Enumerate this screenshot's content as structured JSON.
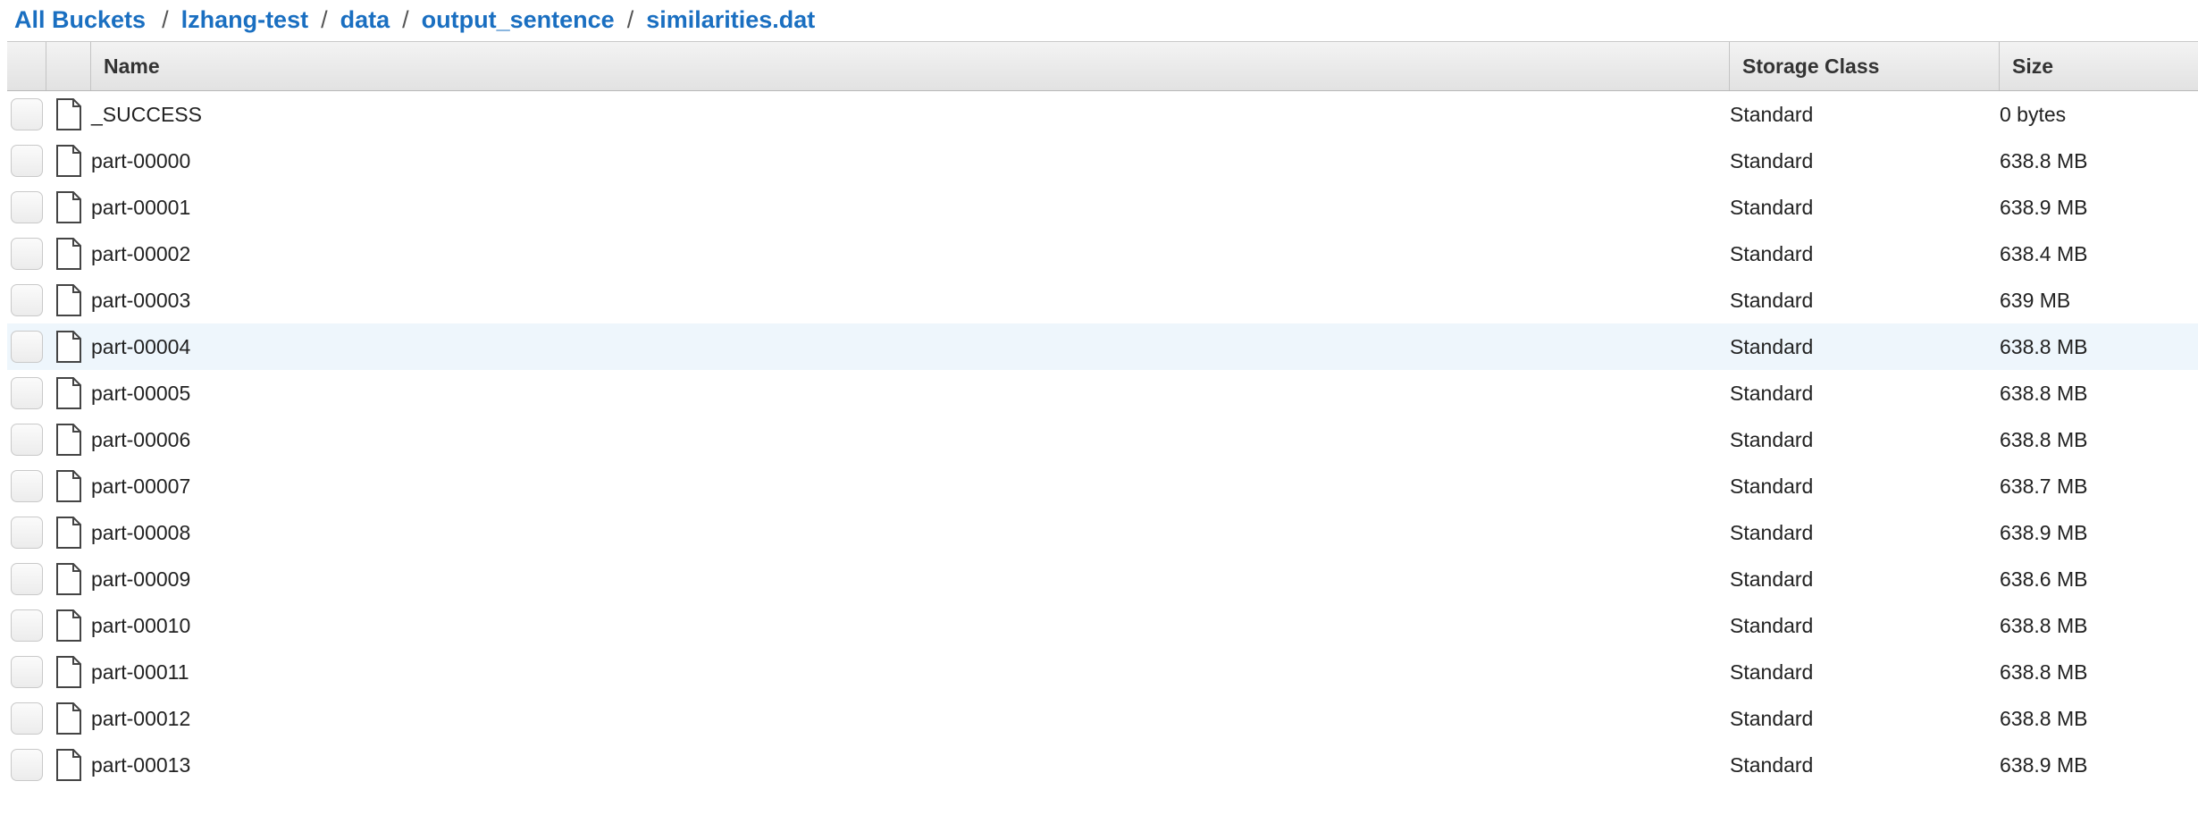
{
  "breadcrumb": {
    "root": "All Buckets",
    "separator": "/",
    "segments": [
      "lzhang-test",
      "data",
      "output_sentence",
      "similarities.dat"
    ]
  },
  "table": {
    "columns": {
      "name": "Name",
      "storage": "Storage Class",
      "size": "Size"
    },
    "rows": [
      {
        "name": "_SUCCESS",
        "storage": "Standard",
        "size": "0 bytes"
      },
      {
        "name": "part-00000",
        "storage": "Standard",
        "size": "638.8 MB"
      },
      {
        "name": "part-00001",
        "storage": "Standard",
        "size": "638.9 MB"
      },
      {
        "name": "part-00002",
        "storage": "Standard",
        "size": "638.4 MB"
      },
      {
        "name": "part-00003",
        "storage": "Standard",
        "size": "639 MB"
      },
      {
        "name": "part-00004",
        "storage": "Standard",
        "size": "638.8 MB",
        "highlighted": true
      },
      {
        "name": "part-00005",
        "storage": "Standard",
        "size": "638.8 MB"
      },
      {
        "name": "part-00006",
        "storage": "Standard",
        "size": "638.8 MB"
      },
      {
        "name": "part-00007",
        "storage": "Standard",
        "size": "638.7 MB"
      },
      {
        "name": "part-00008",
        "storage": "Standard",
        "size": "638.9 MB"
      },
      {
        "name": "part-00009",
        "storage": "Standard",
        "size": "638.6 MB"
      },
      {
        "name": "part-00010",
        "storage": "Standard",
        "size": "638.8 MB"
      },
      {
        "name": "part-00011",
        "storage": "Standard",
        "size": "638.8 MB"
      },
      {
        "name": "part-00012",
        "storage": "Standard",
        "size": "638.8 MB"
      },
      {
        "name": "part-00013",
        "storage": "Standard",
        "size": "638.9 MB"
      }
    ]
  },
  "colors": {
    "link": "#1a6fc1",
    "highlight_row": "#eef6fc"
  },
  "icons": {
    "file": "file-icon"
  }
}
